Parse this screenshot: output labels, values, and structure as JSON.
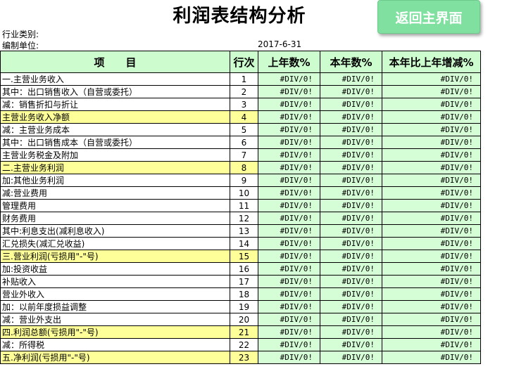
{
  "header": {
    "title": "利润表结构分析",
    "back_button": "返回主界面",
    "industry_label": "行业类别:",
    "unit_label": "编制单位:",
    "date": "2017-6-31"
  },
  "columns": {
    "item": "项　　目",
    "row_no": "行次",
    "last_year": "上年数%",
    "this_year": "本年数%",
    "change": "本年比上年增减%"
  },
  "rows": [
    {
      "label": "一.主营业务收入",
      "no": "1",
      "v1": "#DIV/0!",
      "v2": "#DIV/0!",
      "v3": "#DIV/0!"
    },
    {
      "label": "其中：出口销售收入（自营或委托）",
      "no": "2",
      "v1": "#DIV/0!",
      "v2": "#DIV/0!",
      "v3": "#DIV/0!"
    },
    {
      "label": "减：销售折扣与折让",
      "no": "3",
      "v1": "#DIV/0!",
      "v2": "#DIV/0!",
      "v3": "#DIV/0!"
    },
    {
      "label": "主营业务收入净额",
      "no": "4",
      "v1": "#DIV/0!",
      "v2": "#DIV/0!",
      "v3": "#DIV/0!"
    },
    {
      "label": "减：主营业务成本",
      "no": "5",
      "v1": "#DIV/0!",
      "v2": "#DIV/0!",
      "v3": "#DIV/0!"
    },
    {
      "label": "其中：出口销售成本（自营或委托）",
      "no": "6",
      "v1": "#DIV/0!",
      "v2": "#DIV/0!",
      "v3": "#DIV/0!"
    },
    {
      "label": "主营业务税金及附加",
      "no": "7",
      "v1": "#DIV/0!",
      "v2": "#DIV/0!",
      "v3": "#DIV/0!"
    },
    {
      "label": "二.主营业务利润",
      "no": "8",
      "v1": "#DIV/0!",
      "v2": "#DIV/0!",
      "v3": "#DIV/0!"
    },
    {
      "label": "加:其他业务利润",
      "no": "9",
      "v1": "#DIV/0!",
      "v2": "#DIV/0!",
      "v3": "#DIV/0!"
    },
    {
      "label": "减:营业费用",
      "no": "10",
      "v1": "#DIV/0!",
      "v2": "#DIV/0!",
      "v3": "#DIV/0!"
    },
    {
      "label": "管理费用",
      "no": "11",
      "v1": "#DIV/0!",
      "v2": "#DIV/0!",
      "v3": "#DIV/0!"
    },
    {
      "label": "财务费用",
      "no": "12",
      "v1": "#DIV/0!",
      "v2": "#DIV/0!",
      "v3": "#DIV/0!"
    },
    {
      "label": "其中:利息支出(减利息收入)",
      "no": "13",
      "v1": "#DIV/0!",
      "v2": "#DIV/0!",
      "v3": "#DIV/0!"
    },
    {
      "label": "汇兑损失(减汇兑收益)",
      "no": "14",
      "v1": "#DIV/0!",
      "v2": "#DIV/0!",
      "v3": "#DIV/0!"
    },
    {
      "label": "三.营业利润(亏损用\"-\"号)",
      "no": "15",
      "v1": "#DIV/0!",
      "v2": "#DIV/0!",
      "v3": "#DIV/0!"
    },
    {
      "label": "加:投资收益",
      "no": "16",
      "v1": "#DIV/0!",
      "v2": "#DIV/0!",
      "v3": "#DIV/0!"
    },
    {
      "label": "补贴收入",
      "no": "17",
      "v1": "#DIV/0!",
      "v2": "#DIV/0!",
      "v3": "#DIV/0!"
    },
    {
      "label": "营业外收入",
      "no": "18",
      "v1": "#DIV/0!",
      "v2": "#DIV/0!",
      "v3": "#DIV/0!"
    },
    {
      "label": "加：以前年度损益调整",
      "no": "19",
      "v1": "#DIV/0!",
      "v2": "#DIV/0!",
      "v3": "#DIV/0!"
    },
    {
      "label": "减：营业外支出",
      "no": "20",
      "v1": "#DIV/0!",
      "v2": "#DIV/0!",
      "v3": "#DIV/0!"
    },
    {
      "label": "四.利润总额(亏损用\"-\"号)",
      "no": "21",
      "v1": "#DIV/0!",
      "v2": "#DIV/0!",
      "v3": "#DIV/0!"
    },
    {
      "label": "减：所得税",
      "no": "22",
      "v1": "#DIV/0!",
      "v2": "#DIV/0!",
      "v3": "#DIV/0!"
    },
    {
      "label": "五.净利润(亏损用\"-\"号)",
      "no": "23",
      "v1": "#DIV/0!",
      "v2": "#DIV/0!",
      "v3": "#DIV/0!"
    }
  ],
  "colors": {
    "header_bg": "#cdfdcf",
    "value_bg": "#d6fed6",
    "highlight_bg": "#ffff99",
    "button_bg": "#7fe0a0"
  }
}
